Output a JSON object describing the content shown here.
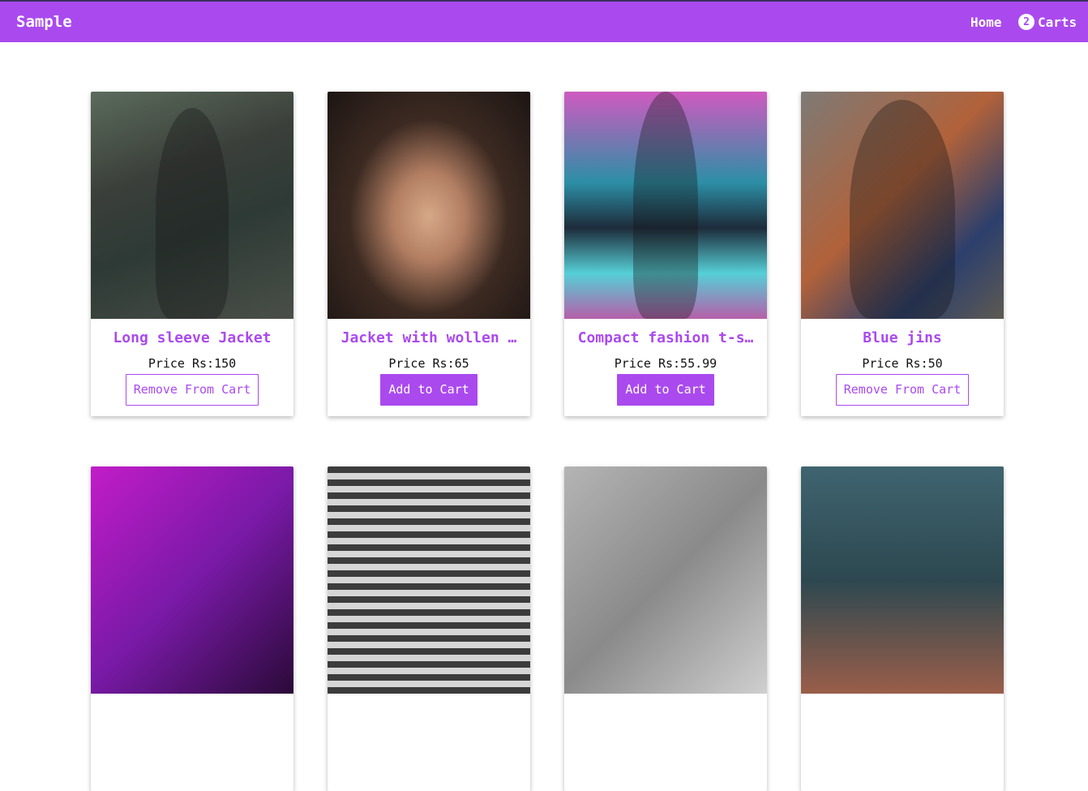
{
  "app": {
    "brand": "Sample",
    "nav": {
      "home_label": "Home",
      "cart_count": "2",
      "cart_label": "Carts"
    }
  },
  "products": [
    {
      "title": "Long sleeve Jacket",
      "price": "Price Rs:150",
      "button": "Remove From Cart",
      "button_type": "remove",
      "image": "woman-denim-jacket-photo"
    },
    {
      "title": "Jacket with wollen …",
      "price": "Price Rs:65",
      "button": "Add to Cart",
      "button_type": "add",
      "image": "woman-fur-hat-photo"
    },
    {
      "title": "Compact fashion t-s…",
      "price": "Price Rs:55.99",
      "button": "Add to Cart",
      "button_type": "add",
      "image": "woman-neon-stairs-photo"
    },
    {
      "title": "Blue jins",
      "price": "Price Rs:50",
      "button": "Remove From Cart",
      "button_type": "remove",
      "image": "woman-blue-jeans-photo"
    },
    {
      "image": "woman-purple-hexagons-photo"
    },
    {
      "image": "building-windows-photo"
    },
    {
      "image": "woman-cap-grayscale-photo"
    },
    {
      "image": "woman-building-photo"
    }
  ],
  "colors": {
    "accent": "#aa4aee",
    "background": "#ffffff",
    "price_text": "#111111"
  }
}
